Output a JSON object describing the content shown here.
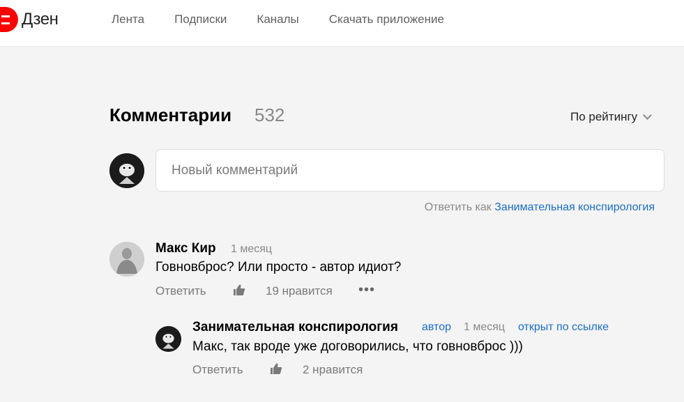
{
  "header": {
    "logo_text": "Дзен",
    "nav": [
      "Лента",
      "Подписки",
      "Каналы",
      "Скачать приложение"
    ]
  },
  "comments": {
    "title": "Комментарии",
    "count": "532",
    "sort_label": "По рейтингу",
    "input_placeholder": "Новый комментарий",
    "reply_as_prefix": "Ответить как",
    "reply_as_name": "Занимательная конспирология"
  },
  "thread": {
    "comment": {
      "author": "Макс Кир",
      "time": "1 месяц",
      "text": "Говновброс? Или просто - автор идиот?",
      "reply_label": "Ответить",
      "likes": "19 нравится",
      "more": "•••"
    },
    "reply": {
      "author": "Занимательная конспирология",
      "author_badge": "автор",
      "time": "1 месяц",
      "link_badge": "открыт по ссылке",
      "text": "Макс, так вроде уже договорились, что говновброс )))",
      "reply_label": "Ответить",
      "likes": "2 нравится"
    }
  },
  "colors": {
    "accent": "#1b6ec2",
    "logo_red": "#ff0000",
    "page_bg": "#f4f4f4"
  }
}
